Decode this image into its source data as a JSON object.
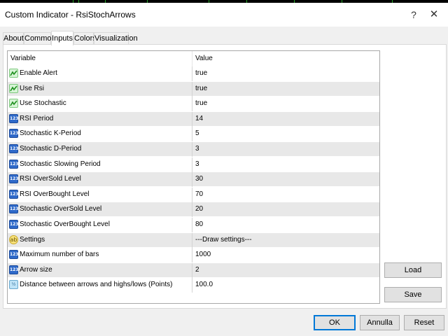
{
  "window": {
    "title": "Custom Indicator - RsiStochArrows",
    "help_label": "?",
    "close_label": "✕"
  },
  "tabs": [
    {
      "label": "About"
    },
    {
      "label": "Common"
    },
    {
      "label": "Inputs",
      "active": true
    },
    {
      "label": "Colors"
    },
    {
      "label": "Visualization"
    }
  ],
  "grid": {
    "headers": {
      "variable": "Variable",
      "value": "Value"
    },
    "rows": [
      {
        "icon": "bool-icon",
        "name": "Enable Alert",
        "value": "true"
      },
      {
        "icon": "bool-icon",
        "name": "Use Rsi",
        "value": "true"
      },
      {
        "icon": "bool-icon",
        "name": "Use Stochastic",
        "value": "true"
      },
      {
        "icon": "integer-icon",
        "name": "RSI Period",
        "value": "14"
      },
      {
        "icon": "integer-icon",
        "name": "Stochastic K-Period",
        "value": "5"
      },
      {
        "icon": "integer-icon",
        "name": "Stochastic D-Period",
        "value": "3"
      },
      {
        "icon": "integer-icon",
        "name": "Stochastic Slowing Period",
        "value": "3"
      },
      {
        "icon": "integer-icon",
        "name": "RSI OverSold Level",
        "value": "30"
      },
      {
        "icon": "integer-icon",
        "name": "RSI OverBought Level",
        "value": "70"
      },
      {
        "icon": "integer-icon",
        "name": "Stochastic OverSold Level",
        "value": "20"
      },
      {
        "icon": "integer-icon",
        "name": "Stochastic OverBought Level",
        "value": "80"
      },
      {
        "icon": "string-icon",
        "name": "Settings",
        "value": "---Draw settings---"
      },
      {
        "icon": "integer-icon",
        "name": "Maximum number of bars",
        "value": "1000"
      },
      {
        "icon": "integer-icon",
        "name": "Arrow size",
        "value": "2"
      },
      {
        "icon": "double-icon",
        "name": "Distance between arrows and highs/lows (Points)",
        "value": "100.0"
      }
    ]
  },
  "side_buttons": {
    "load_label": "Load",
    "save_label": "Save"
  },
  "footer": {
    "ok_label": "OK",
    "cancel_label": "Annulla",
    "reset_label": "Reset"
  },
  "icon_glyphs": {
    "integer": "123",
    "string": "ab",
    "double": "½"
  },
  "colors": {
    "accent": "#0078d7",
    "row_alt": "#e8e8e8",
    "chart_line": "#26a326"
  }
}
